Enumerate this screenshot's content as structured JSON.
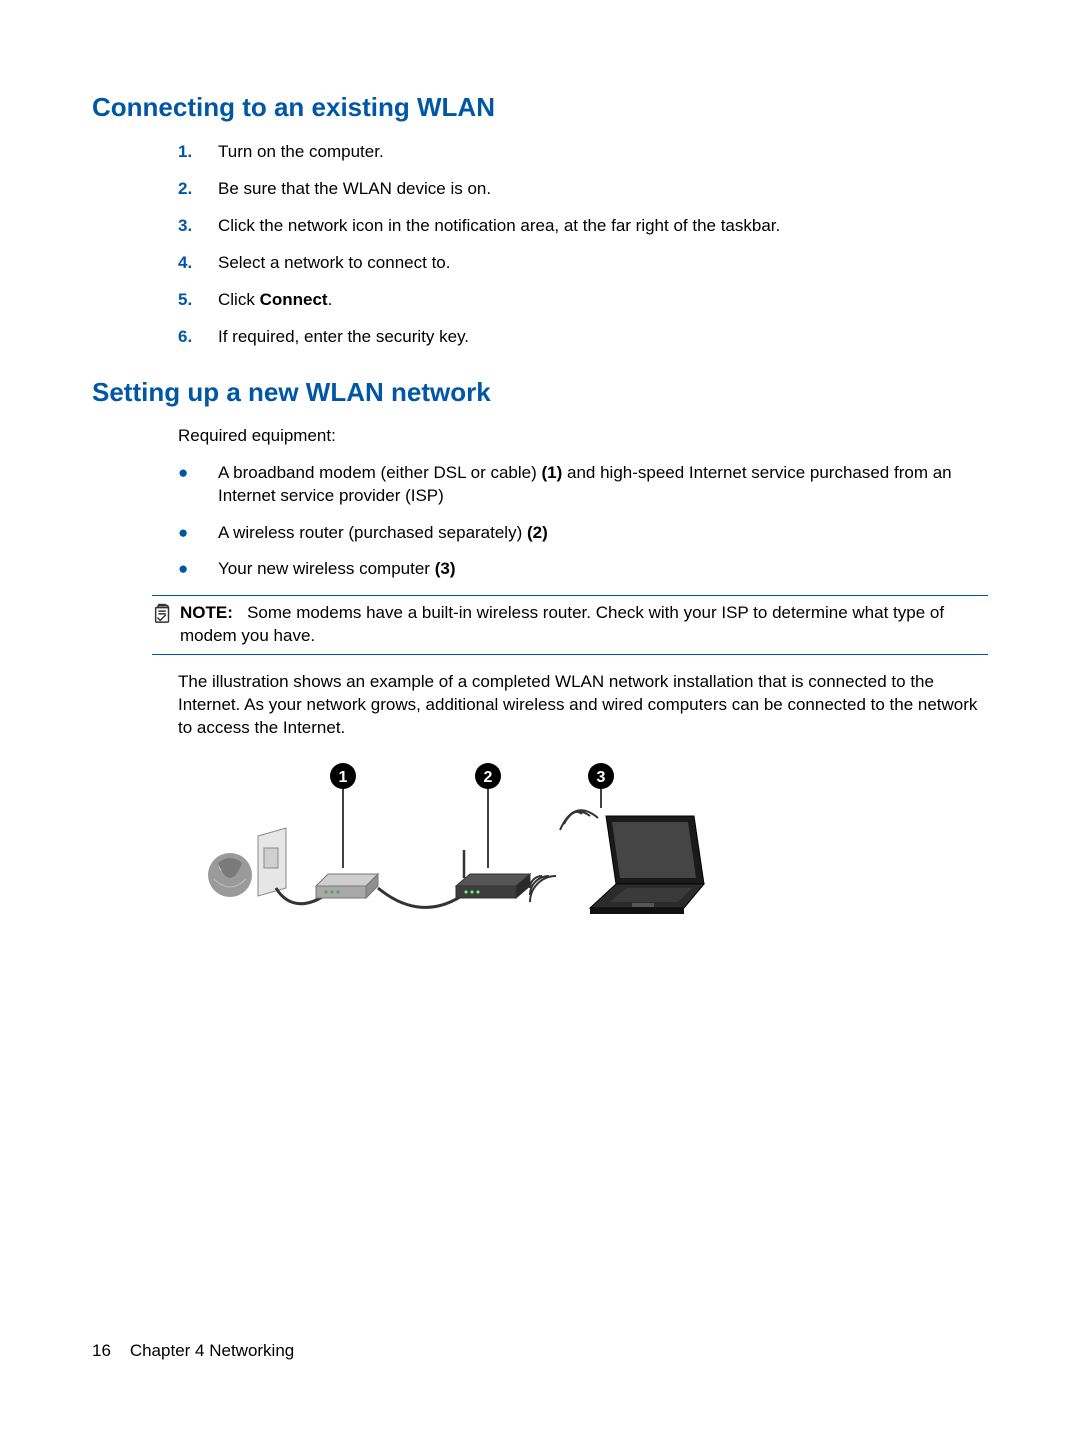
{
  "colors": {
    "accent": "#0057a6"
  },
  "section1": {
    "heading": "Connecting to an existing WLAN",
    "steps": [
      {
        "num": "1.",
        "text": "Turn on the computer."
      },
      {
        "num": "2.",
        "text": "Be sure that the WLAN device is on."
      },
      {
        "num": "3.",
        "text": "Click the network icon in the notification area, at the far right of the taskbar."
      },
      {
        "num": "4.",
        "text": "Select a network to connect to."
      },
      {
        "num": "5.",
        "prefix": "Click ",
        "bold": "Connect",
        "suffix": "."
      },
      {
        "num": "6.",
        "text": "If required, enter the security key."
      }
    ]
  },
  "section2": {
    "heading": "Setting up a new WLAN network",
    "intro": "Required equipment:",
    "bullets": [
      {
        "prefix": "A broadband modem (either DSL or cable) ",
        "bold": "(1)",
        "suffix": " and high-speed Internet service purchased from an Internet service provider (ISP)"
      },
      {
        "prefix": "A wireless router (purchased separately) ",
        "bold": "(2)",
        "suffix": ""
      },
      {
        "prefix": "Your new wireless computer ",
        "bold": "(3)",
        "suffix": ""
      }
    ],
    "note_label": "NOTE:",
    "note_text": "Some modems have a built-in wireless router. Check with your ISP to determine what type of modem you have.",
    "paragraph": "The illustration shows an example of a completed WLAN network installation that is connected to the Internet. As your network grows, additional wireless and wired computers can be connected to the network to access the Internet.",
    "callouts": {
      "c1": "1",
      "c2": "2",
      "c3": "3"
    }
  },
  "footer": {
    "page_number": "16",
    "chapter_label": "Chapter 4   Networking"
  }
}
